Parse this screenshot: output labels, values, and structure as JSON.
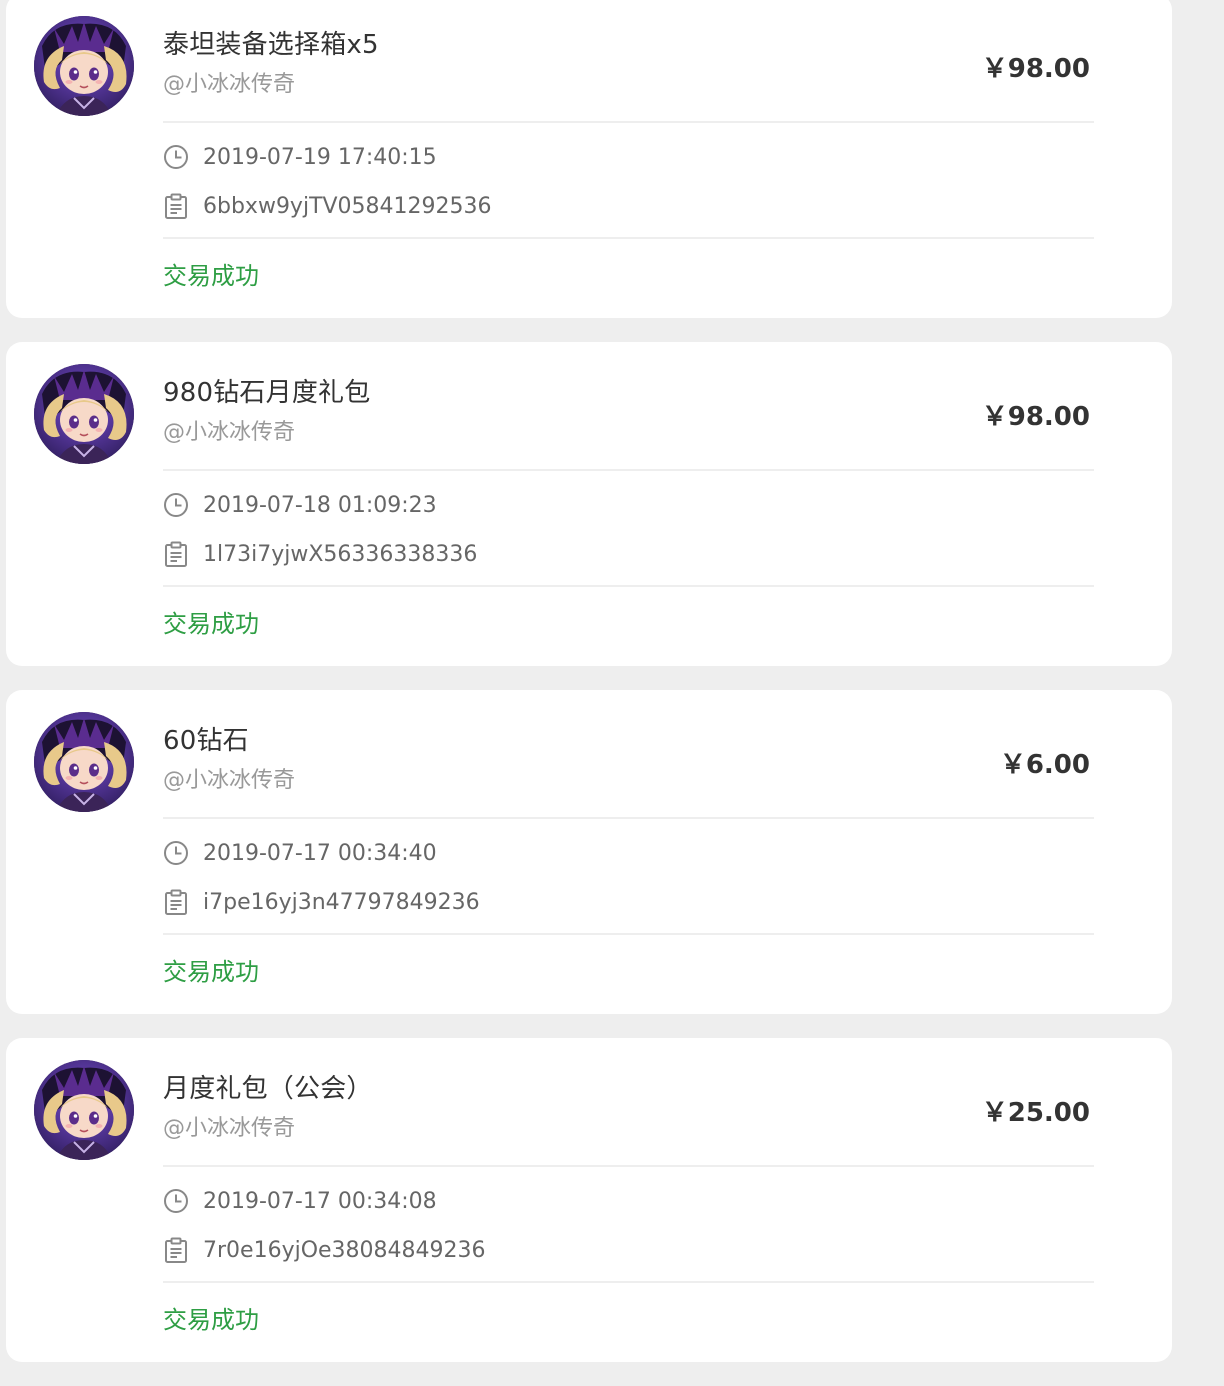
{
  "colors": {
    "page_background": "#eeeeee",
    "card_background": "#ffffff",
    "title_text": "#333333",
    "secondary_text": "#999999",
    "meta_text": "#666666",
    "status_success": "#2e9e44",
    "divider": "#eeeeee"
  },
  "icons": {
    "time": "clock-icon",
    "order_id": "clipboard-icon",
    "avatar": "game-character-avatar"
  },
  "orders": [
    {
      "title": "泰坦装备选择箱x5",
      "seller": "@小冰冰传奇",
      "price": "￥98.00",
      "time": "2019-07-19 17:40:15",
      "order_id": "6bbxw9yjTV05841292536",
      "status": "交易成功"
    },
    {
      "title": "980钻石月度礼包",
      "seller": "@小冰冰传奇",
      "price": "￥98.00",
      "time": "2019-07-18 01:09:23",
      "order_id": "1l73i7yjwX56336338336",
      "status": "交易成功"
    },
    {
      "title": "60钻石",
      "seller": "@小冰冰传奇",
      "price": "￥6.00",
      "time": "2019-07-17 00:34:40",
      "order_id": "i7pe16yj3n47797849236",
      "status": "交易成功"
    },
    {
      "title": "月度礼包（公会）",
      "seller": "@小冰冰传奇",
      "price": "￥25.00",
      "time": "2019-07-17 00:34:08",
      "order_id": "7r0e16yjOe38084849236",
      "status": "交易成功"
    }
  ]
}
